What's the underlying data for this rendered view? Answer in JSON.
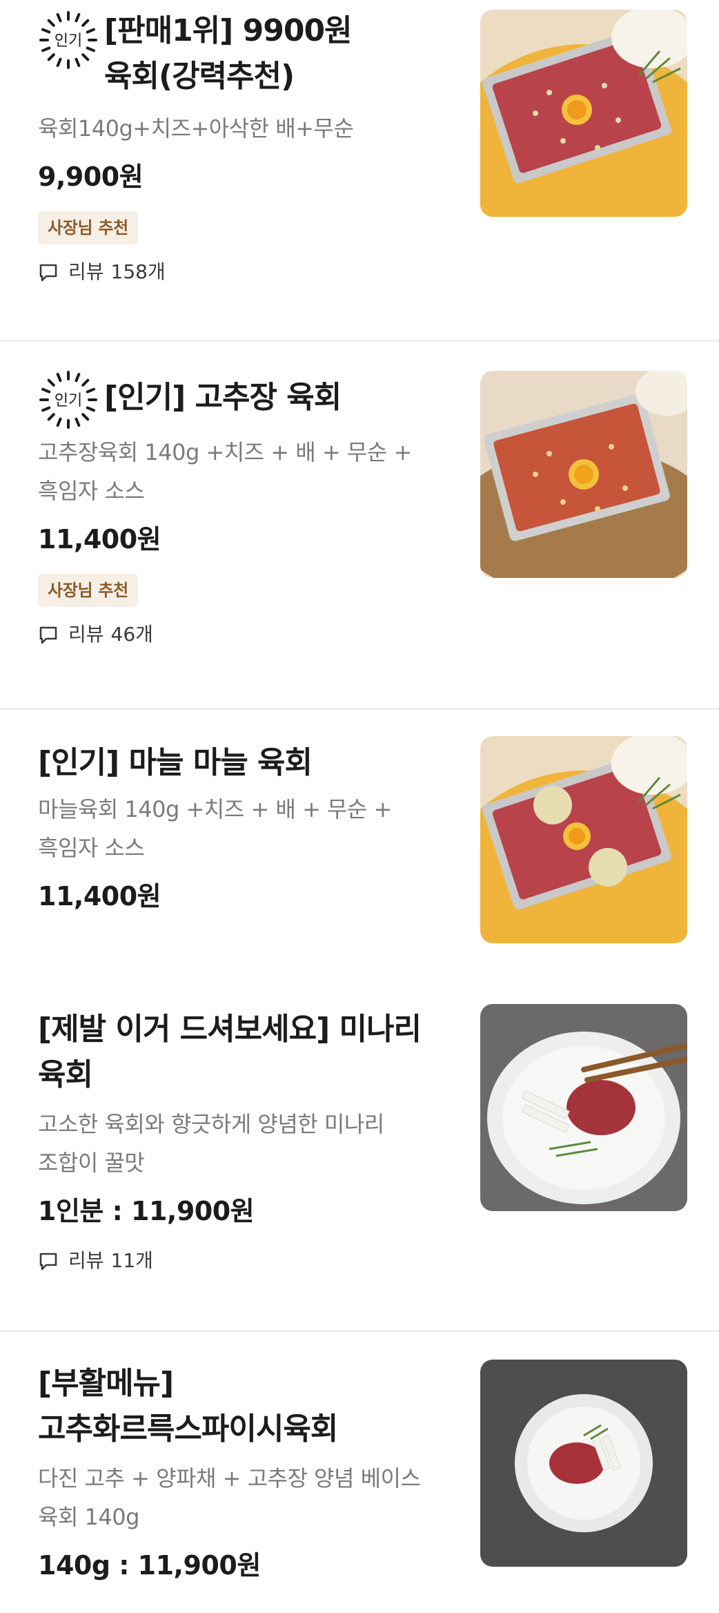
{
  "menu": {
    "items": [
      {
        "badge": "인기",
        "title": "[판매1위] 9900원\n육회(강력추천)",
        "desc": "육회140g+치즈+아삭한 배+무순",
        "price": "9,900원",
        "tag": "사장님 추천",
        "review_label": "리뷰",
        "review_count": "158개",
        "image": "yukhoe-egg-tray"
      },
      {
        "badge": "인기",
        "title": "[인기] 고추장 육회",
        "desc": "고추장육회 140g  +치즈 +  배 + 무순 +\n흑임자 소스",
        "price": "11,400원",
        "tag": "사장님 추천",
        "review_label": "리뷰",
        "review_count": "46개",
        "image": "gochujang-yukhoe-tray"
      },
      {
        "title": "[인기] 마늘 마늘 육회",
        "desc": "마늘육회 140g  +치즈 +  배 + 무순 +\n흑임자 소스",
        "price": "11,400원",
        "image": "garlic-yukhoe-tray"
      },
      {
        "title": "[제발 이거 드셔보세요] 미나리\n육회",
        "desc": "고소한 육회와 향긋하게 양념한 미나리\n조합이 꿀맛",
        "price": "1인분 : 11,900원",
        "review_label": "리뷰",
        "review_count": "11개",
        "image": "minari-yukhoe-plate"
      },
      {
        "title": "[부활메뉴]\n고추화르륵스파이시육회",
        "desc": "다진 고추 + 양파채 + 고추장 양념 베이스\n육회 140g",
        "price": "140g : 11,900원",
        "image": "spicy-yukhoe-plate"
      }
    ]
  },
  "colors": {
    "title": "#1c1c1c",
    "desc": "#7a7a7a",
    "tag_bg": "#f6efe6",
    "tag_text": "#8a5a2b",
    "divider": "#eeeeee"
  },
  "icons": {
    "badge": "popular-sunburst-icon",
    "review": "speech-bubble-icon"
  }
}
